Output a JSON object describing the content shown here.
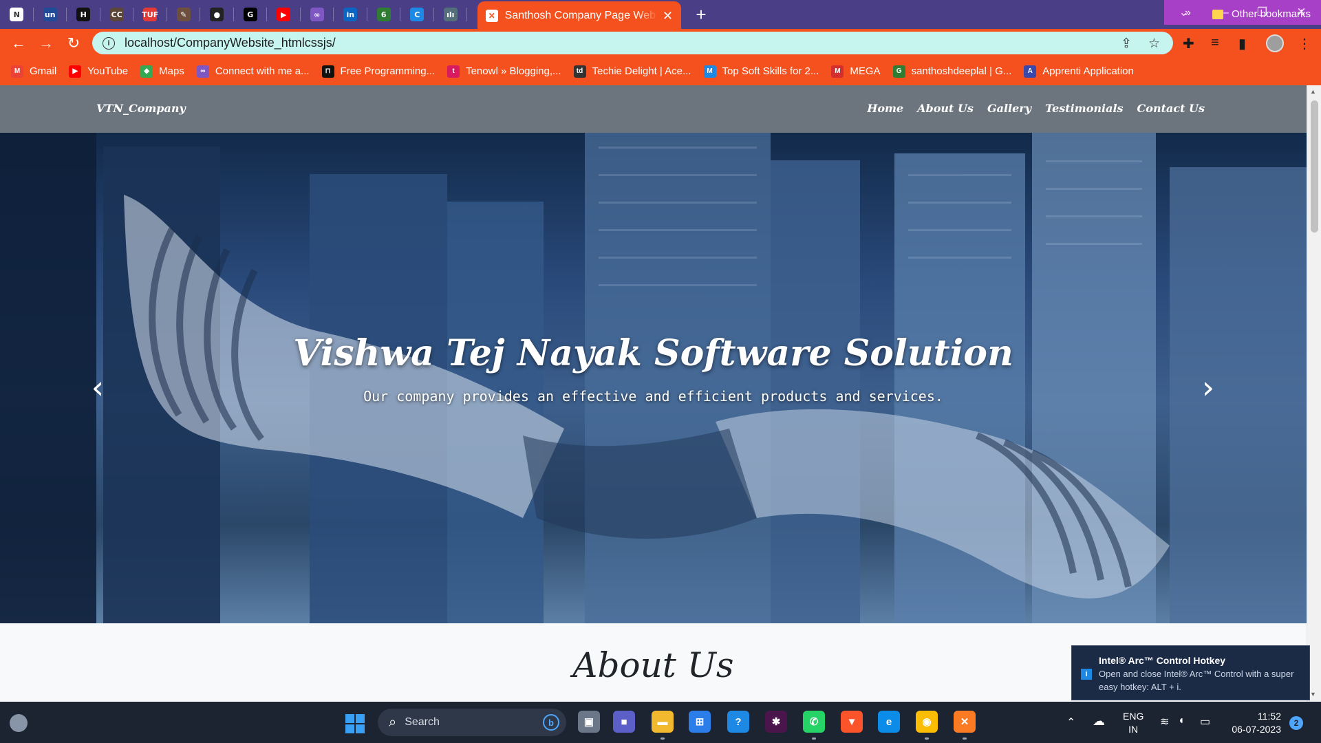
{
  "browser": {
    "pinned_tabs": [
      {
        "icon": "news-icon",
        "glyph": "N",
        "color": "#ffffff"
      },
      {
        "icon": "unstop-icon",
        "glyph": "un",
        "color": "#1f4b99"
      },
      {
        "icon": "hackerearth-icon",
        "glyph": "H",
        "color": "#111111"
      },
      {
        "icon": "codechef-icon",
        "glyph": "CC",
        "color": "#5b4638"
      },
      {
        "icon": "tuf-icon",
        "glyph": "TUF",
        "color": "#e53935"
      },
      {
        "icon": "pen-icon",
        "glyph": "✎",
        "color": "#6c4f3d"
      },
      {
        "icon": "github-icon",
        "glyph": "●",
        "color": "#222222"
      },
      {
        "icon": "sixg-icon",
        "glyph": "G",
        "color": "#000000"
      },
      {
        "icon": "youtube-icon",
        "glyph": "▶",
        "color": "#ff0000"
      },
      {
        "icon": "link-icon",
        "glyph": "∞",
        "color": "#7e57c2"
      },
      {
        "icon": "linkedin-icon",
        "glyph": "in",
        "color": "#0a66c2"
      },
      {
        "icon": "leaf-icon",
        "glyph": "6",
        "color": "#2e7d32"
      },
      {
        "icon": "c-icon",
        "glyph": "C",
        "color": "#1e88e5"
      },
      {
        "icon": "cisco-icon",
        "glyph": "ılı",
        "color": "#546e7a"
      }
    ],
    "active_tab": {
      "title": "Santhosh Company Page Web Site",
      "icon_glyph": "✕"
    },
    "new_tab_label": "+",
    "address": "localhost/CompanyWebsite_htmlcssjs/",
    "bookmarks": [
      {
        "label": "Gmail",
        "icon": "gmail-icon",
        "color": "#ea4335",
        "glyph": "M"
      },
      {
        "label": "YouTube",
        "icon": "youtube-icon",
        "color": "#ff0000",
        "glyph": "▶"
      },
      {
        "label": "Maps",
        "icon": "maps-icon",
        "color": "#34a853",
        "glyph": "◆"
      },
      {
        "label": "Connect with me a...",
        "icon": "connect-icon",
        "color": "#7e57c2",
        "glyph": "∞"
      },
      {
        "label": "Free Programming...",
        "icon": "programming-icon",
        "color": "#111111",
        "glyph": "⊓"
      },
      {
        "label": "Tenowl » Blogging,...",
        "icon": "tenowl-icon",
        "color": "#d81b60",
        "glyph": "t"
      },
      {
        "label": "Techie Delight | Ace...",
        "icon": "techie-delight-icon",
        "color": "#333333",
        "glyph": "td"
      },
      {
        "label": "Top Soft Skills for 2...",
        "icon": "soft-skills-icon",
        "color": "#1e88e5",
        "glyph": "M"
      },
      {
        "label": "MEGA",
        "icon": "mega-icon",
        "color": "#d32f2f",
        "glyph": "M"
      },
      {
        "label": "santhoshdeeplal | G...",
        "icon": "gfg-icon",
        "color": "#2e7d32",
        "glyph": "G"
      },
      {
        "label": "Apprenti Application",
        "icon": "apprenti-icon",
        "color": "#3949ab",
        "glyph": "A"
      }
    ],
    "more_bookmarks": "»",
    "other_bookmarks": "Other bookmarks"
  },
  "site": {
    "brand": "VTN_Company",
    "nav": [
      "Home",
      "About Us",
      "Gallery",
      "Testimonials",
      "Contact Us"
    ],
    "hero_title": "Vishwa Tej Nayak Software Solution",
    "hero_subtitle": "Our company provides an effective and efficient products and services.",
    "about_heading": "About Us"
  },
  "toast": {
    "title": "Intel® Arc™ Control Hotkey",
    "body": "Open and close Intel® Arc™ Control with a super easy hotkey: ALT + i."
  },
  "taskbar": {
    "search_placeholder": "Search",
    "apps": [
      {
        "icon": "task-view-icon",
        "color": "#6b7688",
        "glyph": "▣"
      },
      {
        "icon": "teams-chat-icon",
        "color": "#5b5fc7",
        "glyph": "■"
      },
      {
        "icon": "file-explorer-icon",
        "color": "#f2b92e",
        "glyph": "▬"
      },
      {
        "icon": "store-icon",
        "color": "#2b7de9",
        "glyph": "⊞"
      },
      {
        "icon": "help-icon",
        "color": "#1e88e5",
        "glyph": "?"
      },
      {
        "icon": "slack-icon",
        "color": "#4a154b",
        "glyph": "✱"
      },
      {
        "icon": "whatsapp-icon",
        "color": "#25d366",
        "glyph": "✆"
      },
      {
        "icon": "brave-icon",
        "color": "#fb542b",
        "glyph": "▼"
      },
      {
        "icon": "edge-icon",
        "color": "#0c8ce9",
        "glyph": "e"
      },
      {
        "icon": "chrome-icon",
        "color": "#fbbc04",
        "glyph": "◉"
      },
      {
        "icon": "xampp-icon",
        "color": "#fb7a24",
        "glyph": "✕"
      }
    ],
    "language_top": "ENG",
    "language_bottom": "IN",
    "time": "11:52",
    "date": "06-07-2023",
    "notification_count": "2"
  }
}
